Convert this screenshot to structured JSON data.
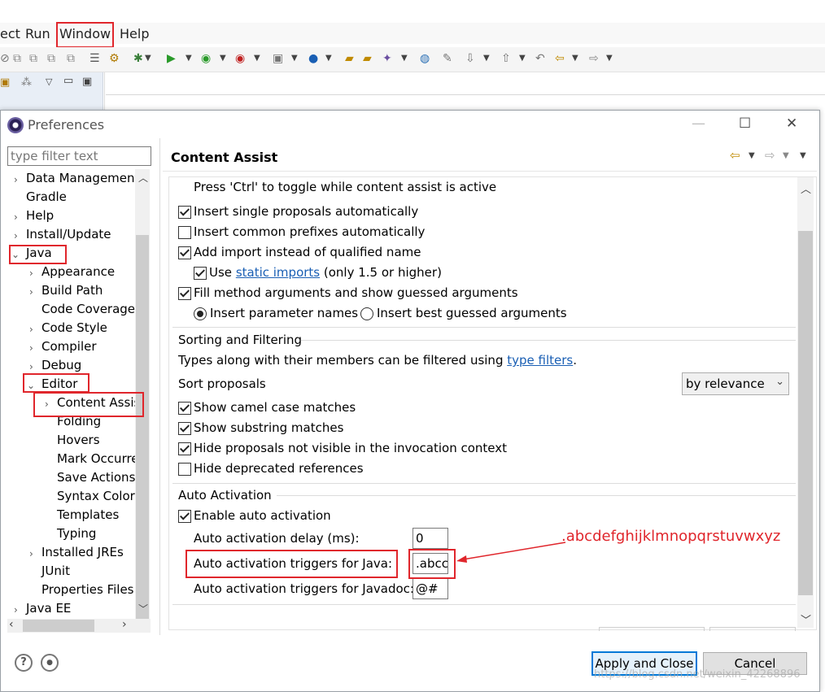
{
  "eclipse": {
    "menu": [
      "ect",
      "Run",
      "Window",
      "Help"
    ]
  },
  "dialog": {
    "title": "Preferences",
    "filter_placeholder": "type filter text",
    "buttons": {
      "apply_close": "Apply and Close",
      "cancel": "Cancel"
    },
    "watermark": "https://blog.csdn.net/weixin_42268896"
  },
  "tree": [
    {
      "label": "Data Management"
    },
    {
      "label": "Gradle"
    },
    {
      "label": "Help"
    },
    {
      "label": "Install/Update"
    },
    {
      "label": "Java"
    },
    {
      "label": "Appearance"
    },
    {
      "label": "Build Path"
    },
    {
      "label": "Code Coverage"
    },
    {
      "label": "Code Style"
    },
    {
      "label": "Compiler"
    },
    {
      "label": "Debug"
    },
    {
      "label": "Editor"
    },
    {
      "label": "Content Assis"
    },
    {
      "label": "Folding"
    },
    {
      "label": "Hovers"
    },
    {
      "label": "Mark Occurre"
    },
    {
      "label": "Save Actions"
    },
    {
      "label": "Syntax Colori"
    },
    {
      "label": "Templates"
    },
    {
      "label": "Typing"
    },
    {
      "label": "Installed JREs"
    },
    {
      "label": "JUnit"
    },
    {
      "label": "Properties Files"
    },
    {
      "label": "Java EE"
    }
  ],
  "page": {
    "title": "Content Assist",
    "toggle_note": "Press 'Ctrl' to toggle while content assist is active",
    "options": [
      {
        "label": "Insert single proposals automatically",
        "checked": true
      },
      {
        "label": "Insert common prefixes automatically",
        "checked": false
      },
      {
        "label": "Add import instead of qualified name",
        "checked": true
      },
      {
        "label": "Use",
        "checked": true
      },
      {
        "label": "Fill method arguments and show guessed arguments",
        "checked": true
      }
    ],
    "static_imports_link": "static imports",
    "static_imports_suffix": "(only 1.5 or higher)",
    "radio_insert_param": "Insert parameter names",
    "radio_insert_best": "Insert best guessed arguments",
    "sorting": {
      "heading": "Sorting and Filtering",
      "desc": "Types along with their members can be filtered using",
      "desc_link": "type filters",
      "desc_end": ".",
      "sort_label": "Sort proposals",
      "sort_value": "by relevance",
      "options": [
        {
          "label": "Show camel case matches",
          "checked": true
        },
        {
          "label": "Show substring matches",
          "checked": true
        },
        {
          "label": "Hide proposals not visible in the invocation context",
          "checked": true
        },
        {
          "label": "Hide deprecated references",
          "checked": false
        }
      ]
    },
    "auto": {
      "heading": "Auto Activation",
      "enable_label": "Enable auto activation",
      "enable_checked": true,
      "delay_label": "Auto activation delay (ms):",
      "delay_value": "0",
      "java_label": "Auto activation triggers for Java:",
      "java_value": ".abcc",
      "javadoc_label": "Auto activation triggers for Javadoc:",
      "javadoc_value": "@#"
    }
  },
  "annotation": {
    "text": ".abcdefghijklmnopqrstuvwxyz",
    "color": "#e0262c"
  }
}
